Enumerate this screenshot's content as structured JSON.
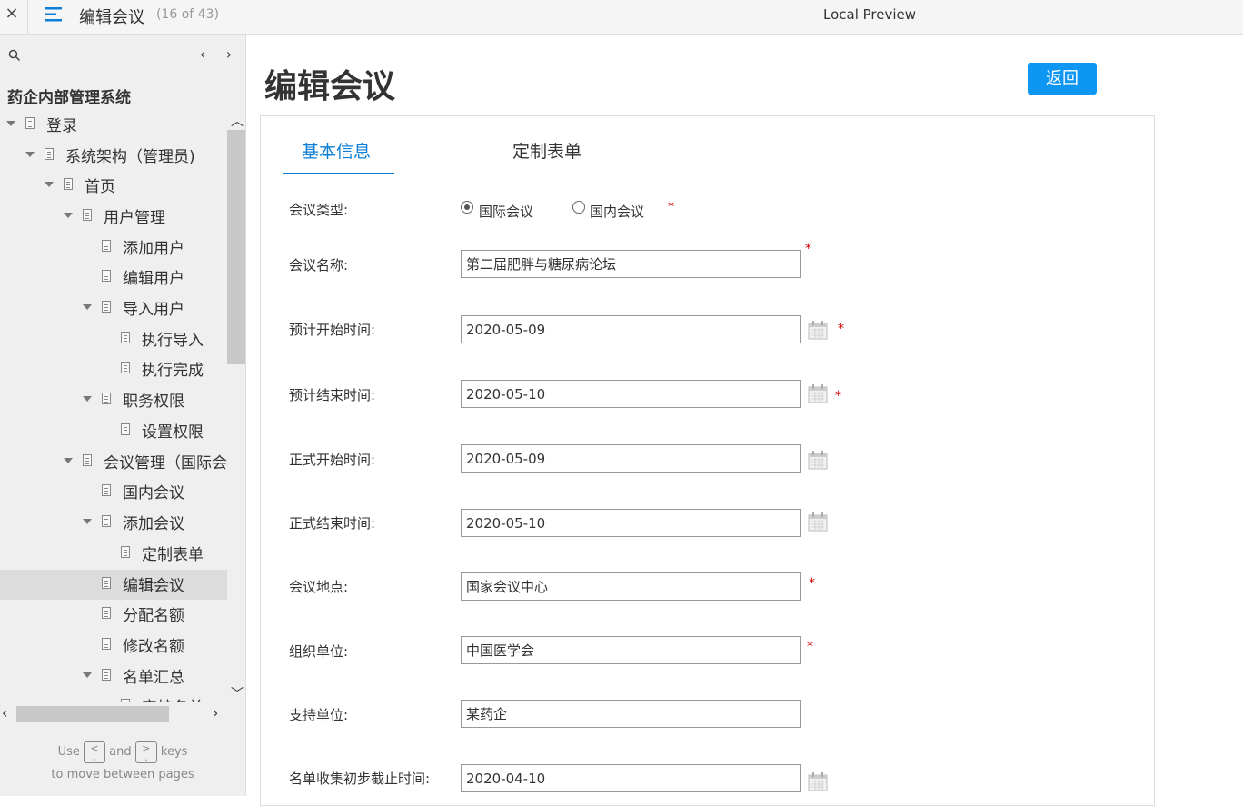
{
  "topbar": {
    "close": "×",
    "title": "编辑会议",
    "count": "(16 of 43)",
    "preview": "Local Preview"
  },
  "sidebar": {
    "project_title": "药企内部管理系统",
    "prev": "‹",
    "next": "›",
    "items": [
      {
        "label": "登录"
      },
      {
        "label": "系统架构（管理员)"
      },
      {
        "label": "首页"
      },
      {
        "label": "用户管理"
      },
      {
        "label": "添加用户"
      },
      {
        "label": "编辑用户"
      },
      {
        "label": "导入用户"
      },
      {
        "label": "执行导入"
      },
      {
        "label": "执行完成"
      },
      {
        "label": "职务权限"
      },
      {
        "label": "设置权限"
      },
      {
        "label": "会议管理（国际会"
      },
      {
        "label": "国内会议"
      },
      {
        "label": "添加会议"
      },
      {
        "label": "定制表单"
      },
      {
        "label": "编辑会议"
      },
      {
        "label": "分配名额"
      },
      {
        "label": "修改名额"
      },
      {
        "label": "名单汇总"
      },
      {
        "label": "审核名单"
      }
    ],
    "hint": {
      "use": "Use",
      "and": "and",
      "keys": "keys",
      "line2": "to move between pages",
      "key_prev": "<\n,",
      "key_next": ">\n."
    }
  },
  "main": {
    "heading": "编辑会议",
    "back_button": "返回",
    "tabs": [
      {
        "label": "基本信息"
      },
      {
        "label": "定制表单"
      }
    ],
    "form": {
      "type_label": "会议类型:",
      "type_options": [
        "国际会议",
        "国内会议"
      ],
      "type_selected": "国际会议",
      "required_mark": "*",
      "name_label": "会议名称:",
      "name_value": "第二届肥胖与糖尿病论坛",
      "plan_start_label": "预计开始时间:",
      "plan_start_value": "2020-05-09",
      "plan_end_label": "预计结束时间:",
      "plan_end_value": "2020-05-10",
      "official_start_label": "正式开始时间:",
      "official_start_value": "2020-05-09",
      "official_end_label": "正式结束时间:",
      "official_end_value": "2020-05-10",
      "location_label": "会议地点:",
      "location_value": "国家会议中心",
      "organizer_label": "组织单位:",
      "organizer_value": "中国医学会",
      "supporter_label": "支持单位:",
      "supporter_value": "某药企",
      "deadline_label": "名单收集初步截止时间:",
      "deadline_value": "2020-04-10"
    }
  },
  "colors": {
    "accent": "#0d96f2",
    "tab_active": "#0d7fd6",
    "required": "#d40000"
  }
}
